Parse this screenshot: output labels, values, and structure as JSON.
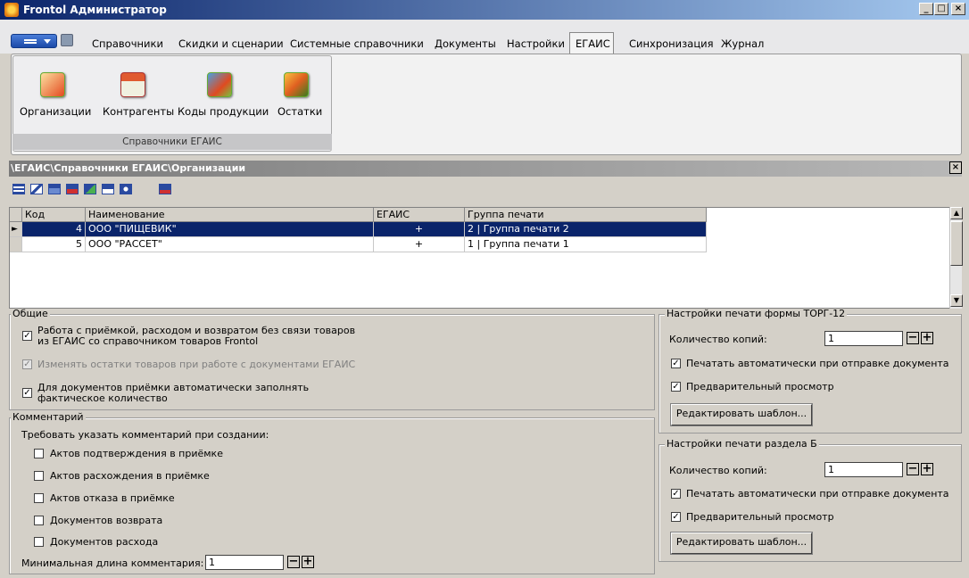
{
  "window": {
    "title": "Frontol Администратор",
    "min": "_",
    "max": "□",
    "close": "×"
  },
  "menu": {
    "items": [
      "Справочники",
      "Скидки и сценарии",
      "Системные справочники",
      "Документы",
      "Настройки",
      "ЕГАИС",
      "Синхронизация",
      "Журнал"
    ],
    "active": "ЕГАИС"
  },
  "ribbon": {
    "group_label": "Справочники ЕГАИС",
    "buttons": [
      "Организации",
      "Контрагенты",
      "Коды продукции",
      "Остатки"
    ]
  },
  "path": "\\ЕГАИС\\Справочники ЕГАИС\\Организации",
  "close_glyph": "×",
  "grid": {
    "columns": [
      "Код",
      "Наименование",
      "ЕГАИС",
      "Группа печати"
    ],
    "rows": [
      {
        "code": "4",
        "name": "ООО \"ПИЩЕВИК\"",
        "egais": "+",
        "group": "2 | Группа печати 2",
        "selected": true
      },
      {
        "code": "5",
        "name": "ООО \"РАССЕТ\"",
        "egais": "+",
        "group": "1 | Группа печати 1",
        "selected": false
      }
    ],
    "row_indicator": "►",
    "scroll_up": "▲",
    "scroll_down": "▼"
  },
  "general": {
    "title": "Общие",
    "opt1_line1": "Работа с приёмкой, расходом и возвратом без связи товаров",
    "opt1_line2": "из ЕГАИС со справочником товаров Frontol",
    "opt2": "Изменять остатки товаров при работе с документами ЕГАИС",
    "opt3_line1": "Для документов приёмки автоматически заполнять",
    "opt3_line2": "фактическое количество",
    "check": "✓"
  },
  "comment": {
    "title": "Комментарий",
    "require": "Требовать указать комментарий при создании:",
    "options": [
      "Актов подтверждения в приёмке",
      "Актов расхождения в приёмке",
      "Актов отказа в приёмке",
      "Документов возврата",
      "Документов расхода"
    ],
    "min_len_label": "Минимальная длина комментария:",
    "min_len_value": "1"
  },
  "torg12": {
    "title": "Настройки печати формы ТОРГ-12",
    "copies_label": "Количество копий:",
    "copies_value": "1",
    "auto_print": "Печатать автоматически при отправке документа",
    "preview": "Предварительный просмотр",
    "edit_button": "Редактировать шаблон..."
  },
  "sectionB": {
    "title": "Настройки печати раздела Б",
    "copies_label": "Количество копий:",
    "copies_value": "1",
    "auto_print": "Печатать автоматически при отправке документа",
    "preview": "Предварительный просмотр",
    "edit_button": "Редактировать шаблон..."
  },
  "stepper": {
    "minus": "−",
    "plus": "+"
  }
}
